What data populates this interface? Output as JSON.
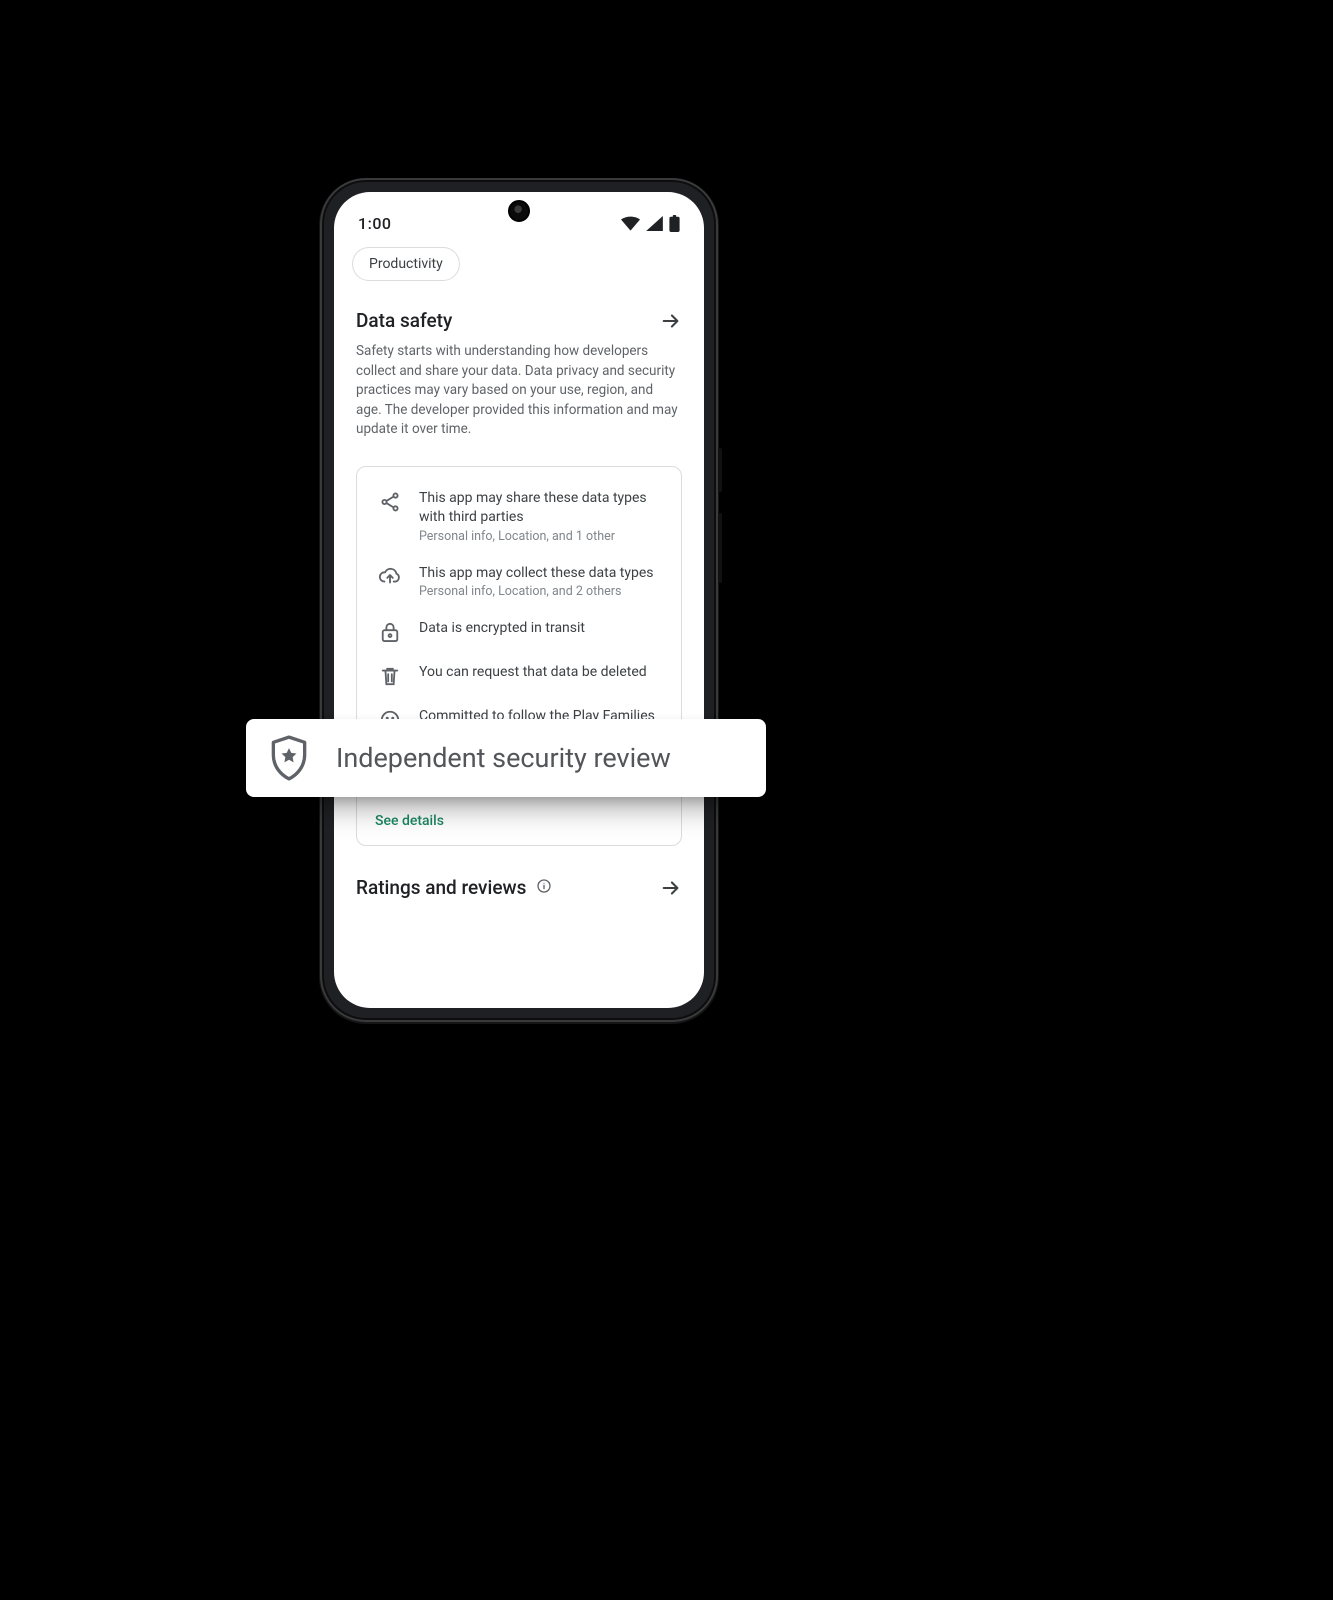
{
  "status": {
    "time": "1:00"
  },
  "chip": {
    "label": "Productivity"
  },
  "data_safety": {
    "title": "Data safety",
    "description": "Safety starts with understanding how developers collect and share your data. Data privacy and security practices may vary based on your use, region, and age. The developer provided this information and may update it over time.",
    "rows": [
      {
        "icon": "share",
        "title": "This app may share these data types with third parties",
        "sub": "Personal info, Location, and 1 other"
      },
      {
        "icon": "cloud-upload",
        "title": "This app may collect these data types",
        "sub": "Personal info, Location, and 2 others"
      },
      {
        "icon": "lock",
        "title": "Data is encrypted in transit",
        "sub": ""
      },
      {
        "icon": "trash",
        "title": "You can request that data be deleted",
        "sub": ""
      },
      {
        "icon": "smile",
        "title": "Committed to follow the Play Families Policy",
        "sub": ""
      }
    ],
    "see_details": "See details"
  },
  "ratings": {
    "title": "Ratings and reviews"
  },
  "callout": {
    "label": "Independent security review"
  }
}
